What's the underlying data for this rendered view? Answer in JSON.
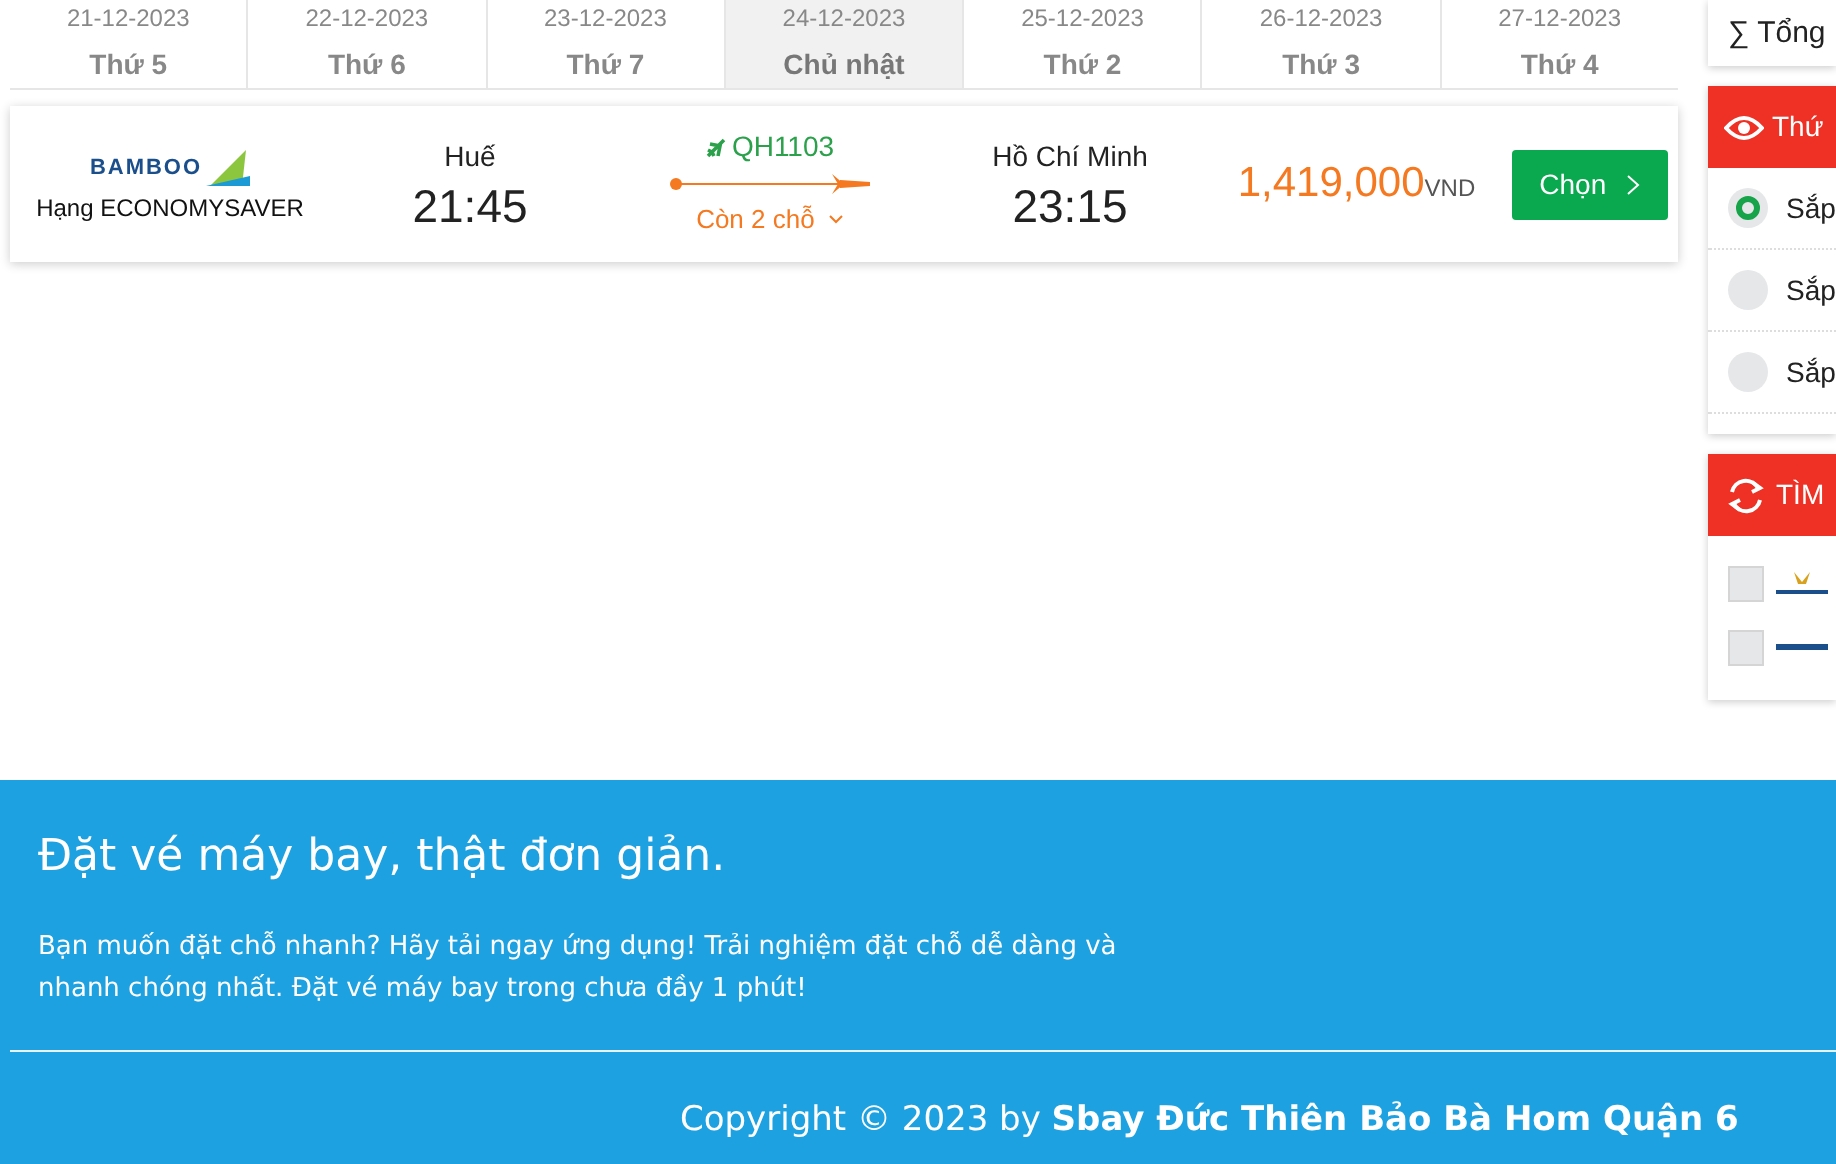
{
  "date_tabs": [
    {
      "date": "21-12-2023",
      "weekday": "Thứ 5",
      "selected": false
    },
    {
      "date": "22-12-2023",
      "weekday": "Thứ 6",
      "selected": false
    },
    {
      "date": "23-12-2023",
      "weekday": "Thứ 7",
      "selected": false
    },
    {
      "date": "24-12-2023",
      "weekday": "Chủ nhật",
      "selected": true
    },
    {
      "date": "25-12-2023",
      "weekday": "Thứ 2",
      "selected": false
    },
    {
      "date": "26-12-2023",
      "weekday": "Thứ 3",
      "selected": false
    },
    {
      "date": "27-12-2023",
      "weekday": "Thứ 4",
      "selected": false
    }
  ],
  "flight": {
    "airline_logo": "BAMBOO",
    "fare_class": "Hạng ECONOMYSAVER",
    "from_city": "Huế",
    "depart_time": "21:45",
    "flight_number": "QH1103",
    "seats_left": "Còn 2 chỗ",
    "to_city": "Hồ Chí Minh",
    "arrive_time": "23:15",
    "price": "1,419,000",
    "currency": "VND",
    "select_button": "Chọn"
  },
  "sidebar": {
    "total": "∑ Tổng",
    "sort_panel": {
      "title": "Thứ",
      "options": [
        {
          "label": "Sắp",
          "selected": true
        },
        {
          "label": "Sắp",
          "selected": false
        },
        {
          "label": "Sắp",
          "selected": false
        }
      ]
    },
    "filter_panel": {
      "title": "TÌM",
      "airlines": [
        {
          "checked": false
        },
        {
          "checked": false
        }
      ]
    }
  },
  "footer": {
    "heading": "Đặt vé máy bay, thật đơn giản.",
    "text": "Bạn muốn đặt chỗ nhanh? Hãy tải ngay ứng dụng! Trải nghiệm đặt chỗ dễ dàng và nhanh chóng nhất. Đặt vé máy bay trong chưa đầy 1 phút!",
    "copyright": "Copyright © 2023 by ",
    "copyright_bold": "Sbay Đức Thiên Bảo Bà Hom Quận 6"
  }
}
